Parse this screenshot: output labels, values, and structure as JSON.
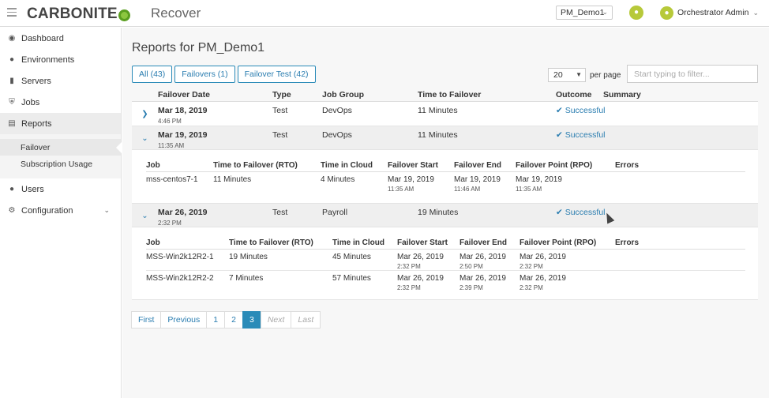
{
  "header": {
    "logo_text": "CARBONITE",
    "app_title": "Recover",
    "env_selected": "PM_Demo1",
    "user_name": "Orchestrator Admin"
  },
  "sidebar": {
    "items": [
      {
        "label": "Dashboard",
        "icon": "dashboard-icon"
      },
      {
        "label": "Environments",
        "icon": "globe-icon"
      },
      {
        "label": "Servers",
        "icon": "server-icon"
      },
      {
        "label": "Jobs",
        "icon": "shield-icon"
      },
      {
        "label": "Reports",
        "icon": "report-icon"
      },
      {
        "label": "Users",
        "icon": "users-icon"
      },
      {
        "label": "Configuration",
        "icon": "gear-icon"
      }
    ],
    "reports_sub": [
      "Failover",
      "Subscription Usage"
    ]
  },
  "main": {
    "title": "Reports for PM_Demo1",
    "tabs": [
      "All (43)",
      "Failovers (1)",
      "Failover Test (42)"
    ],
    "per_page_value": "20",
    "per_page_label": "per page",
    "filter_placeholder": "Start typing to filter...",
    "columns": [
      "Failover Date",
      "Type",
      "Job Group",
      "Time to Failover",
      "Outcome",
      "Summary"
    ],
    "rows": [
      {
        "date": "Mar 18, 2019",
        "time": "4:46 PM",
        "type": "Test",
        "group": "DevOps",
        "ttf": "11 Minutes",
        "outcome": "Successful"
      },
      {
        "date": "Mar 19, 2019",
        "time": "11:35 AM",
        "type": "Test",
        "group": "DevOps",
        "ttf": "11 Minutes",
        "outcome": "Successful"
      },
      {
        "date": "Mar 26, 2019",
        "time": "2:32 PM",
        "type": "Test",
        "group": "Payroll",
        "ttf": "19 Minutes",
        "outcome": "Successful"
      }
    ],
    "detail_columns": [
      "Job",
      "Time to Failover (RTO)",
      "Time in Cloud",
      "Failover Start",
      "Failover End",
      "Failover Point (RPO)",
      "Errors"
    ],
    "detail1": [
      {
        "job": "mss-centos7-1",
        "rto": "11 Minutes",
        "cloud": "4 Minutes",
        "start_d": "Mar 19, 2019",
        "start_t": "11:35 AM",
        "end_d": "Mar 19, 2019",
        "end_t": "11:46 AM",
        "rpo_d": "Mar 19, 2019",
        "rpo_t": "11:35 AM"
      }
    ],
    "detail2": [
      {
        "job": "MSS-Win2k12R2-1",
        "rto": "19 Minutes",
        "cloud": "45 Minutes",
        "start_d": "Mar 26, 2019",
        "start_t": "2:32 PM",
        "end_d": "Mar 26, 2019",
        "end_t": "2:50 PM",
        "rpo_d": "Mar 26, 2019",
        "rpo_t": "2:32 PM"
      },
      {
        "job": "MSS-Win2k12R2-2",
        "rto": "7 Minutes",
        "cloud": "57 Minutes",
        "start_d": "Mar 26, 2019",
        "start_t": "2:32 PM",
        "end_d": "Mar 26, 2019",
        "end_t": "2:39 PM",
        "rpo_d": "Mar 26, 2019",
        "rpo_t": "2:32 PM"
      }
    ],
    "pager": [
      "First",
      "Previous",
      "1",
      "2",
      "3",
      "Next",
      "Last"
    ]
  }
}
